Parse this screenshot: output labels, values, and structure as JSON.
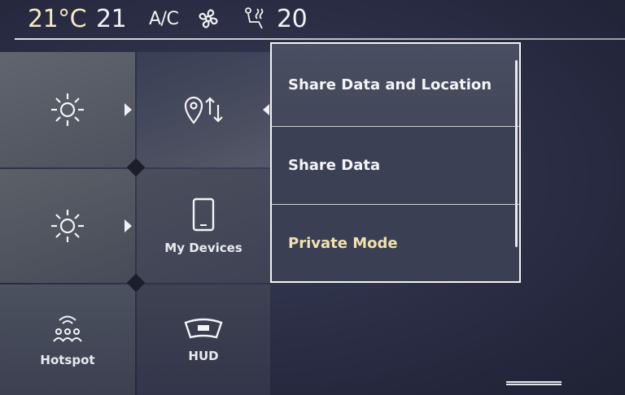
{
  "climate_bar": {
    "temp_left": "21°C",
    "fan_speed": "21",
    "ac_label": "A/C",
    "temp_right": "20",
    "icons": [
      "fan-icon",
      "seat-heat-icon"
    ]
  },
  "tiles": {
    "brightness_1": {
      "icon": "brightness-icon"
    },
    "location": {
      "icon": "location-share-icon"
    },
    "brightness_2": {
      "icon": "brightness-icon"
    },
    "devices": {
      "icon": "phone-icon",
      "label": "My Devices"
    },
    "hotspot": {
      "icon": "hotspot-icon",
      "label": "Hotspot"
    },
    "hud": {
      "icon": "hud-icon",
      "label": "HUD"
    }
  },
  "menu": {
    "items": [
      {
        "label": "Share Data and Location",
        "selected": false
      },
      {
        "label": "Share Data",
        "selected": false
      },
      {
        "label": "Private Mode",
        "selected": true
      }
    ],
    "selected_color": "#f1e2b0"
  },
  "colors": {
    "background": "#2a2d44",
    "accent_text": "#f7e7c4"
  }
}
